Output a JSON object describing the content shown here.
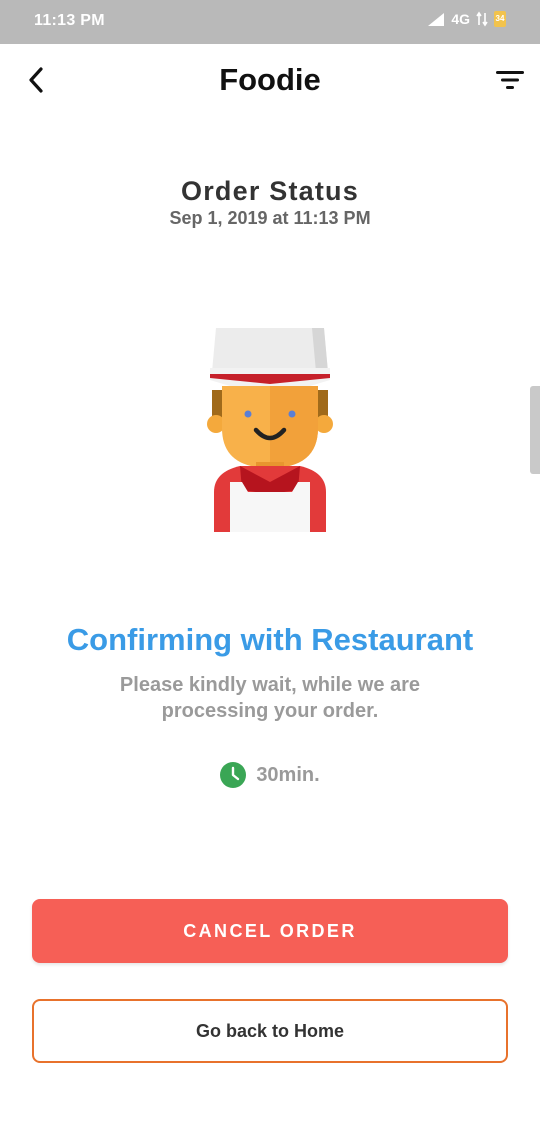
{
  "status_bar": {
    "time": "11:13 PM",
    "network": "4G",
    "battery": "34"
  },
  "app_bar": {
    "title": "Foodie"
  },
  "order": {
    "title": "Order Status",
    "datetime": "Sep 1, 2019 at 11:13 PM",
    "status_heading": "Confirming with Restaurant",
    "status_message": "Please kindly wait, while we are processing your order.",
    "eta": "30min."
  },
  "actions": {
    "cancel_label": "CANCEL ORDER",
    "home_label": "Go back to Home"
  },
  "colors": {
    "accent_blue": "#3a9be6",
    "cancel_red": "#f65f56",
    "home_border_orange": "#e8722c",
    "clock_green": "#3aa655"
  },
  "icons": {
    "back": "back-arrow-icon",
    "filter": "filter-icon",
    "clock": "clock-icon",
    "illustration": "chef-icon"
  }
}
